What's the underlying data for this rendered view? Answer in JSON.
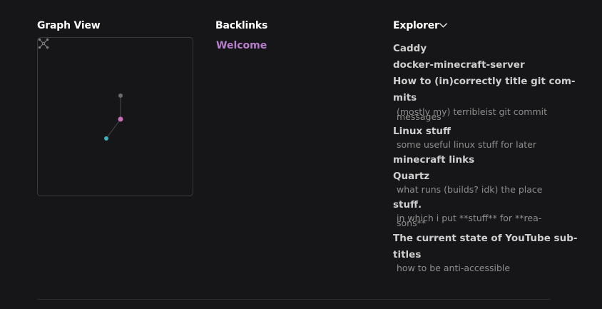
{
  "graph_view": {
    "title": "Graph View"
  },
  "backlinks": {
    "title": "Backlinks",
    "items": [
      "Welcome"
    ]
  },
  "explorer": {
    "title": "Explorer",
    "items": [
      {
        "title": "Caddy"
      },
      {
        "title": "docker-minecraft-server"
      },
      {
        "title": "How to (in)correctly title git com-",
        "title_cont": "mits",
        "desc": "(mostly my) terribleist git commit",
        "desc_cont": "messages"
      },
      {
        "title": "Linux stuff",
        "desc": "some useful linux stuff for later"
      },
      {
        "title": "minecraft links"
      },
      {
        "title": "Quartz",
        "desc": "what runs (builds? idk) the place"
      },
      {
        "title": "stuff.",
        "desc": "in which i put **stuff** for **rea-",
        "desc_cont": "sons**"
      },
      {
        "title": "The current state of YouTube sub-",
        "title_cont": "titles",
        "desc": "how to be anti-accessible"
      }
    ]
  },
  "colors": {
    "background": "#161618",
    "accent": "#b77fcc",
    "node_gray": "#6b6b6b",
    "node_pink": "#c56fb4",
    "node_teal": "#3fb0b8"
  }
}
